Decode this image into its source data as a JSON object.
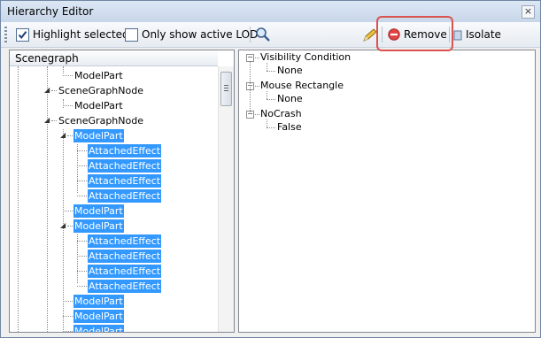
{
  "window": {
    "title": "Hierarchy Editor",
    "close_glyph": "×"
  },
  "toolbar": {
    "highlight_selected": {
      "label": "Highlight selected",
      "checked": true
    },
    "only_active_lod": {
      "label": "Only show active LOD",
      "checked": false
    },
    "remove_label": "Remove",
    "isolate_label": "Isolate"
  },
  "scenegraph": {
    "header": "Scenegraph",
    "rows": [
      {
        "label": "ModelPart",
        "selected": false,
        "expanded": null
      },
      {
        "label": "SceneGraphNode",
        "selected": false,
        "expanded": true
      },
      {
        "label": "ModelPart",
        "selected": false,
        "expanded": null
      },
      {
        "label": "SceneGraphNode",
        "selected": false,
        "expanded": true
      },
      {
        "label": "ModelPart",
        "selected": true,
        "expanded": true
      },
      {
        "label": "AttachedEffect",
        "selected": true,
        "expanded": null
      },
      {
        "label": "AttachedEffect",
        "selected": true,
        "expanded": null
      },
      {
        "label": "AttachedEffect",
        "selected": true,
        "expanded": null
      },
      {
        "label": "AttachedEffect",
        "selected": true,
        "expanded": null
      },
      {
        "label": "ModelPart",
        "selected": true,
        "expanded": null
      },
      {
        "label": "ModelPart",
        "selected": true,
        "expanded": true
      },
      {
        "label": "AttachedEffect",
        "selected": true,
        "expanded": null
      },
      {
        "label": "AttachedEffect",
        "selected": true,
        "expanded": null
      },
      {
        "label": "AttachedEffect",
        "selected": true,
        "expanded": null
      },
      {
        "label": "AttachedEffect",
        "selected": true,
        "expanded": null
      },
      {
        "label": "ModelPart",
        "selected": true,
        "expanded": null
      },
      {
        "label": "ModelPart",
        "selected": true,
        "expanded": null
      },
      {
        "label": "ModelPart",
        "selected": true,
        "expanded": null
      }
    ]
  },
  "properties": [
    {
      "name": "Visibility Condition",
      "value": "None"
    },
    {
      "name": "Mouse Rectangle",
      "value": "None"
    },
    {
      "name": "NoCrash",
      "value": "False"
    }
  ],
  "colors": {
    "selection": "#3399ff",
    "highlight_box": "#d9534f",
    "remove_icon": "#e04343"
  },
  "icons": [
    "check-icon",
    "magnifier-icon",
    "pencil-icon",
    "remove-icon",
    "isolate-icon",
    "collapse-triangle-icon",
    "expander-minus-icon"
  ]
}
